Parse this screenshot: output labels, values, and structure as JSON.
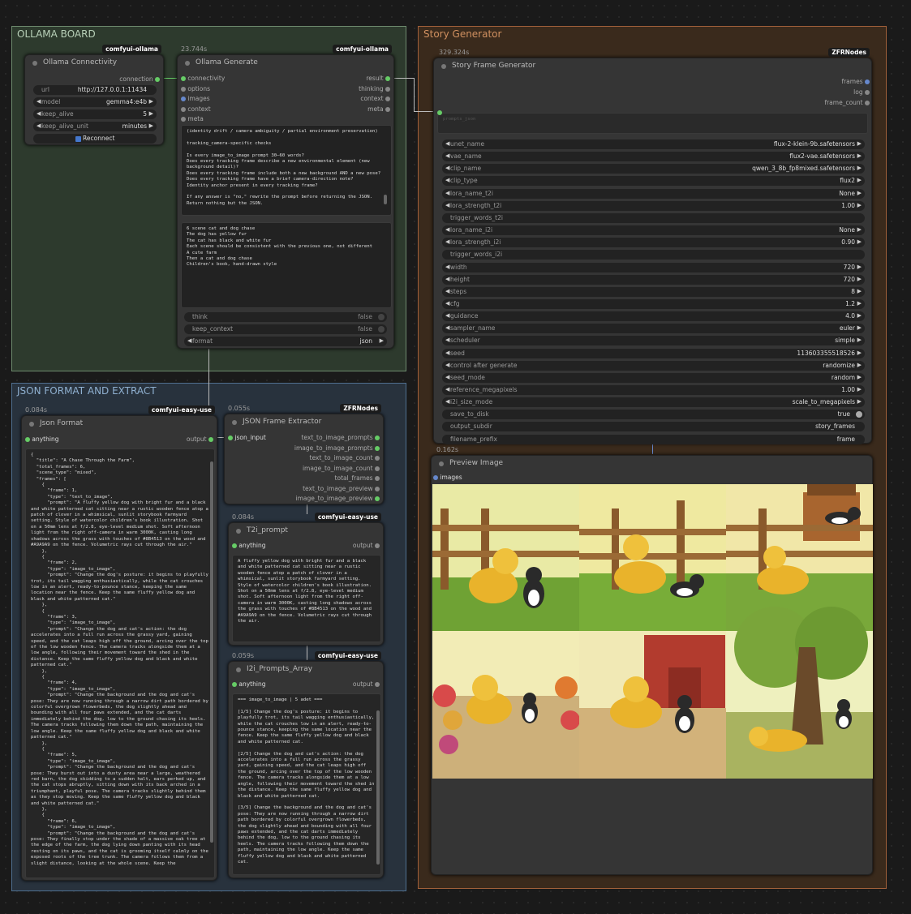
{
  "groups": {
    "ollama": "OLLAMA BOARD",
    "json": "JSON FORMAT AND EXTRACT",
    "story": "Story Generator"
  },
  "conn": {
    "badge": "comfyui-ollama",
    "title": "Ollama Connectivity",
    "out": "connection",
    "url_l": "url",
    "url_v": "http://127.0.0.1:11434",
    "model_l": "model",
    "model_v": "gemma4:e4b",
    "ka_l": "keep_alive",
    "ka_v": "5",
    "kau_l": "keep_alive_unit",
    "kau_v": "minutes",
    "reconnect": "Reconnect"
  },
  "gen": {
    "time": "23.744s",
    "badge": "comfyui-ollama",
    "title": "Ollama Generate",
    "inputs": [
      "connectivity",
      "options",
      "images",
      "context",
      "meta"
    ],
    "outputs": [
      "result",
      "thinking",
      "context",
      "meta"
    ],
    "system_text": "(identity drift / camera ambiguity / partial environment preservation)\n\ntracking_camera-specific checks\n\nIs every image_to_image prompt 30–60 words?\nDoes every tracking frame describe a new environmental element (new background detail)?\nDoes every tracking frame include both a new background AND a new pose?\nDoes every tracking frame have a brief camera-direction note?\nIdentity anchor present in every tracking frame?\n\nIf any answer is \"no,\" rewrite the prompt before returning the JSON.\nReturn nothing but the JSON.",
    "prompt_text": "6 scene cat and dog chase\nThe dog has yellow fur\nThe cat has black and white fur\nEach scene should be consistent with the previous one, not different\nA cute farm\nThen a cat and dog chase\nChildren's book, hand-drawn style",
    "think_l": "think",
    "think_v": "false",
    "kc_l": "keep_context",
    "kc_v": "false",
    "fmt_l": "format",
    "fmt_v": "json"
  },
  "jf": {
    "time": "0.084s",
    "badge": "comfyui-easy-use",
    "title": "Json Format",
    "in": "anything",
    "out": "output",
    "text": "{\n  \"title\": \"A Chase Through the Farm\",\n  \"total_frames\": 6,\n  \"scene_type\": \"mixed\",\n  \"frames\": [\n    {\n      \"frame\": 1,\n      \"type\": \"text_to_image\",\n      \"prompt\": \"A fluffy yellow dog with bright fur and a black and white patterned cat sitting near a rustic wooden fence atop a patch of clover in a whimsical, sunlit storybook farmyard setting. Style of watercolor children's book illustration. Shot on a 50mm lens at f/2.8, eye-level medium shot. Soft afternoon light from the right off-camera in warm 3000K, casting long shadows across the grass with touches of #8B4513 on the wood and #A9A9A9 on the fence. Volumetric rays cut through the air.\"\n    },\n    {\n      \"frame\": 2,\n      \"type\": \"image_to_image\",\n      \"prompt\": \"Change the dog's posture: it begins to playfully trot, its tail wagging enthusiastically, while the cat crouches low in an alert, ready-to-pounce stance, keeping the same location near the fence. Keep the same fluffy yellow dog and black and white patterned cat.\"\n    },\n    {\n      \"frame\": 3,\n      \"type\": \"image_to_image\",\n      \"prompt\": \"Change the dog and cat's action: the dog accelerates into a full run across the grassy yard, gaining speed, and the cat leaps high off the ground, arcing over the top of the low wooden fence. The camera tracks alongside them at a low angle, following their movement toward the shed in the distance. Keep the same fluffy yellow dog and black and white patterned cat.\"\n    },\n    {\n      \"frame\": 4,\n      \"type\": \"image_to_image\",\n      \"prompt\": \"Change the background and the dog and cat's pose: They are now running through a narrow dirt path bordered by colorful overgrown flowerbeds, the dog slightly ahead and bounding with all four paws extended, and the cat darts immediately behind the dog, low to the ground chasing its heels. The camera tracks following them down the path, maintaining the low angle. Keep the same fluffy yellow dog and black and white patterned cat.\"\n    },\n    {\n      \"frame\": 5,\n      \"type\": \"image_to_image\",\n      \"prompt\": \"Change the background and the dog and cat's pose: They burst out into a dusty area near a large, weathered red barn, the dog skidding to a sudden halt, ears perked up, and the cat stops abruptly, sitting down with its back arched in a triumphant, playful pose. The camera tracks slightly behind them as they stop moving. Keep the same fluffy yellow dog and black and white patterned cat.\"\n    },\n    {\n      \"frame\": 6,\n      \"type\": \"image_to_image\",\n      \"prompt\": \"Change the background and the dog and cat's pose: They finally stop under the shade of a massive oak tree at the edge of the farm, the dog lying down panting with its head resting on its paws, and the cat is grooming itself calmly on the exposed roots of the tree trunk. The camera follows them from a slight distance, looking at the whole scene. Keep the"
  },
  "jfe": {
    "time": "0.055s",
    "badge": "ZFRNodes",
    "title": "JSON Frame Extractor",
    "in": "json_input",
    "outputs": [
      "text_to_image_prompts",
      "image_to_image_prompts",
      "text_to_image_count",
      "image_to_image_count",
      "total_frames",
      "text_to_image_preview",
      "image_to_image_preview"
    ]
  },
  "t2i": {
    "time": "0.084s",
    "badge": "comfyui-easy-use",
    "title": "T2i_prompt",
    "in": "anything",
    "out": "output",
    "text": "A fluffy yellow dog with bright fur and a black and white patterned cat sitting near a rustic wooden fence atop a patch of clover in a whimsical, sunlit storybook farmyard setting. Style of watercolor children's book illustration. Shot on a 50mm lens at f/2.8, eye-level medium shot. Soft afternoon light from the right off-camera in warm 3000K, casting long shadows across the grass with touches of #8B4513 on the wood and #A9A9A9 on the fence. Volumetric rays cut through the air."
  },
  "i2i": {
    "time": "0.059s",
    "badge": "comfyui-easy-use",
    "title": "I2i_Prompts_Array",
    "in": "anything",
    "out": "output",
    "text": "=== image_to_image | 5 adet ===\n\n[1/5] Change the dog's posture: it begins to playfully trot, its tail wagging enthusiastically, while the cat crouches low in an alert, ready-to-pounce stance, keeping the same location near the fence. Keep the same fluffy yellow dog and black and white patterned cat.\n\n[2/5] Change the dog and cat's action: the dog accelerates into a full run across the grassy yard, gaining speed, and the cat leaps high off the ground, arcing over the top of the low wooden fence. The camera tracks alongside them at a low angle, following their movement toward the shed in the distance. Keep the same fluffy yellow dog and black and white patterned cat.\n\n[3/5] Change the background and the dog and cat's pose: They are now running through a narrow dirt path bordered by colorful overgrown flowerbeds, the dog slightly ahead and bounding with all four paws extended, and the cat darts immediately behind the dog, low to the ground chasing its heels. The camera tracks following them down the path, maintaining the low angle. Keep the same fluffy yellow dog and black and white patterned cat."
  },
  "sfg": {
    "time": "329.324s",
    "badge": "ZFRNodes",
    "title": "Story Frame Generator",
    "outputs": [
      "frames",
      "log",
      "frame_count"
    ],
    "prompt_ph": "prompts_json",
    "widgets": [
      {
        "l": "unet_name",
        "v": "flux-2-klein-9b.safetensors",
        "a": 1
      },
      {
        "l": "vae_name",
        "v": "flux2-vae.safetensors",
        "a": 1
      },
      {
        "l": "clip_name",
        "v": "qwen_3_8b_fp8mixed.safetensors",
        "a": 1
      },
      {
        "l": "clip_type",
        "v": "flux2",
        "a": 1
      },
      {
        "l": "lora_name_t2i",
        "v": "None",
        "a": 1
      },
      {
        "l": "lora_strength_t2i",
        "v": "1.00",
        "a": 1
      },
      {
        "l": "trigger_words_t2i",
        "v": "",
        "a": 0
      },
      {
        "l": "lora_name_i2i",
        "v": "None",
        "a": 1
      },
      {
        "l": "lora_strength_i2i",
        "v": "0.90",
        "a": 1
      },
      {
        "l": "trigger_words_i2i",
        "v": "",
        "a": 0
      },
      {
        "l": "width",
        "v": "720",
        "a": 1
      },
      {
        "l": "height",
        "v": "720",
        "a": 1
      },
      {
        "l": "steps",
        "v": "8",
        "a": 1
      },
      {
        "l": "cfg",
        "v": "1.2",
        "a": 1
      },
      {
        "l": "guidance",
        "v": "4.0",
        "a": 1
      },
      {
        "l": "sampler_name",
        "v": "euler",
        "a": 1
      },
      {
        "l": "scheduler",
        "v": "simple",
        "a": 1
      },
      {
        "l": "seed",
        "v": "113603355518526",
        "a": 1
      },
      {
        "l": "control after generate",
        "v": "randomize",
        "a": 1
      },
      {
        "l": "seed_mode",
        "v": "random",
        "a": 1
      },
      {
        "l": "reference_megapixels",
        "v": "1.00",
        "a": 1
      },
      {
        "l": "i2i_size_mode",
        "v": "scale_to_megapixels",
        "a": 1
      },
      {
        "l": "save_to_disk",
        "v": "true",
        "a": 2
      },
      {
        "l": "output_subdir",
        "v": "story_frames",
        "a": 0
      },
      {
        "l": "filename_prefix",
        "v": "frame",
        "a": 0
      }
    ]
  },
  "preview": {
    "time": "0.162s",
    "title": "Preview Image",
    "in": "images"
  },
  "colors": {
    "ollama_bg": "#2d3a2d",
    "ollama_border": "#6d8a6d",
    "json_bg": "#28323d",
    "json_border": "#4f6f8f",
    "story_bg": "#3a2a1c",
    "story_border": "#a0603a",
    "link_green": "#6c6"
  }
}
